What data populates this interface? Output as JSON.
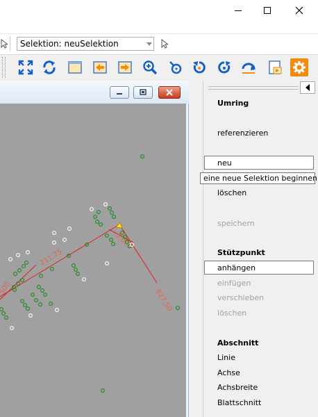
{
  "selection_toolbar": {
    "label": "Selektion: neuSelektion"
  },
  "toolbar_icons": [
    "fit-all-icon",
    "refresh-icon",
    "frame-icon",
    "arrow-left-icon",
    "arrow-right-icon",
    "zoom-in-icon",
    "pan-icon",
    "rotate-left-icon",
    "rotate-right-icon",
    "undo-arc-icon",
    "export-icon",
    "settings-icon"
  ],
  "canvas": {
    "labels": [
      "211,75",
      "827,50",
      "5,000",
      "500"
    ],
    "line_color": "#e02020",
    "point_color_green": "#1a8a1a",
    "point_color_white": "#ffffff",
    "background": "#a0a0a0"
  },
  "panel": {
    "umring_title": "Umring",
    "referenzieren": "referenzieren",
    "neu": "neu",
    "tooltip": "eine neue Selektion beginnen",
    "loeschen": "löschen",
    "speichern": "speichern",
    "stuetzpunkt_title": "Stützpunkt",
    "anhaengen": "anhängen",
    "einfuegen": "einfügen",
    "verschieben": "verschieben",
    "loeschen2": "löschen",
    "abschnitt_title": "Abschnitt",
    "linie": "Linie",
    "achse": "Achse",
    "achsbreite": "Achsbreite",
    "blattschnitt": "Blattschnitt"
  }
}
